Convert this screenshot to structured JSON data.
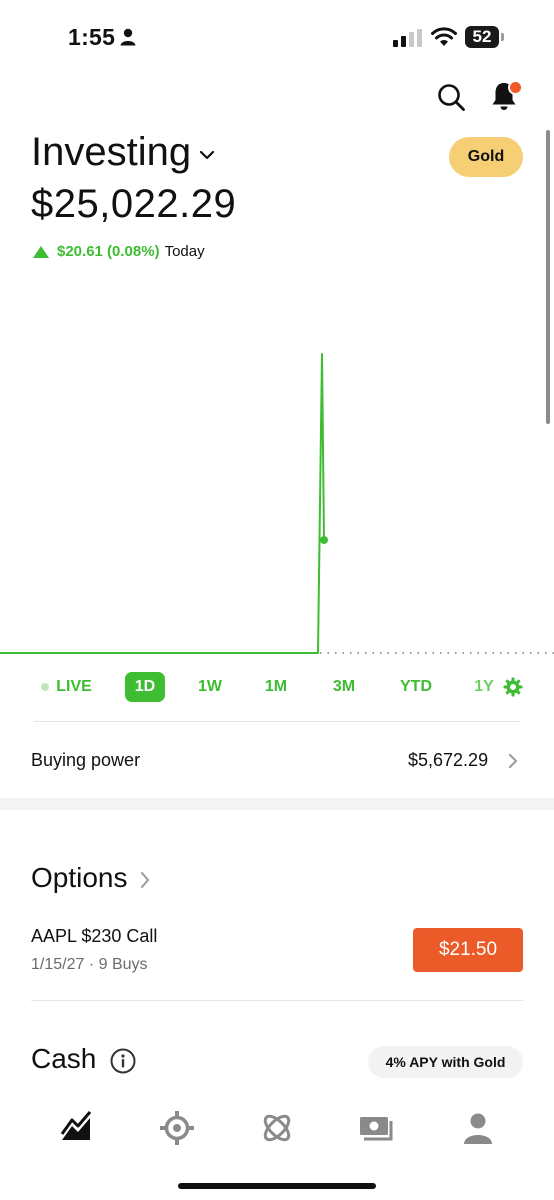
{
  "status_bar": {
    "time": "1:55",
    "battery": "52"
  },
  "header": {
    "title": "Investing",
    "gold_label": "Gold"
  },
  "portfolio": {
    "balance": "$25,022.29",
    "change": "$20.61 (0.08%)",
    "change_period": "Today",
    "change_color": "#3ebd32"
  },
  "ranges": {
    "live": "LIVE",
    "items": [
      "1D",
      "1W",
      "1M",
      "3M",
      "YTD",
      "1Y"
    ],
    "selected": "1D"
  },
  "buying_power": {
    "label": "Buying power",
    "value": "$5,672.29"
  },
  "options": {
    "title": "Options",
    "position": {
      "name": "AAPL $230 Call",
      "detail": "1/15/27 · 9 Buys",
      "price": "$21.50"
    }
  },
  "cash": {
    "title": "Cash",
    "apy_label": "4% APY with Gold"
  },
  "nav": {
    "items": [
      "investing-icon",
      "crypto-icon",
      "strategies-icon",
      "cash-icon",
      "account-icon"
    ]
  },
  "colors": {
    "accent": "#3ebd32",
    "gold": "#f6cf74",
    "price_button": "#eb5b29",
    "notification_dot": "#f05a24"
  }
}
